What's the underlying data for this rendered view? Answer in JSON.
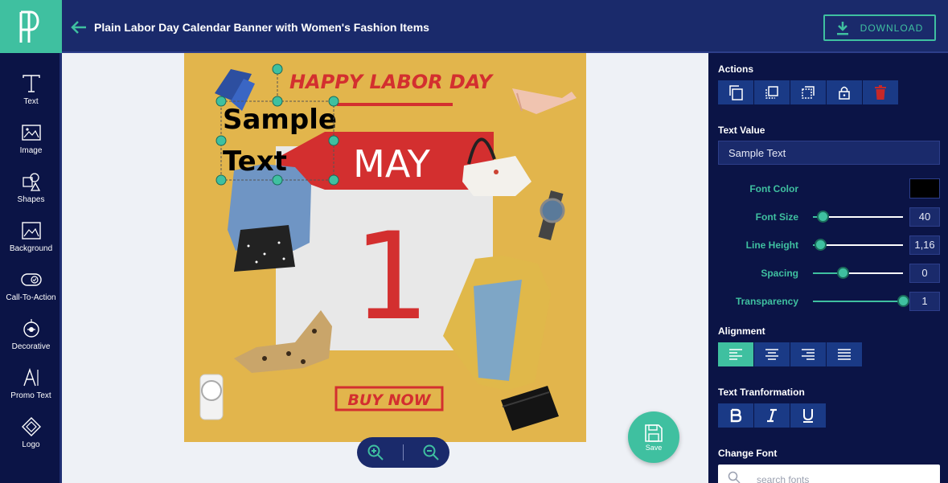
{
  "header": {
    "title": "Plain Labor Day Calendar Banner with Women's Fashion Items",
    "download_label": "DOWNLOAD"
  },
  "sidebar": {
    "items": [
      {
        "label": "Text",
        "icon": "text-icon"
      },
      {
        "label": "Image",
        "icon": "image-icon"
      },
      {
        "label": "Shapes",
        "icon": "shapes-icon"
      },
      {
        "label": "Background",
        "icon": "background-icon"
      },
      {
        "label": "Call-To-Action",
        "icon": "cta-icon"
      },
      {
        "label": "Decorative",
        "icon": "decorative-icon"
      },
      {
        "label": "Promo Text",
        "icon": "promo-text-icon"
      },
      {
        "label": "Logo",
        "icon": "logo-icon"
      }
    ]
  },
  "canvas": {
    "headline": "HAPPY LABOR DAY",
    "month": "MAY",
    "day": "1",
    "cta": "BUY NOW",
    "selected_text_line1": "Sample",
    "selected_text_line2": "Text"
  },
  "save_label": "Save",
  "panel": {
    "actions_title": "Actions",
    "text_value_title": "Text Value",
    "text_value": "Sample Text",
    "font_color_label": "Font Color",
    "font_color": "#000000",
    "font_size_label": "Font Size",
    "font_size": "40",
    "line_height_label": "Line Height",
    "line_height": "1,16",
    "spacing_label": "Spacing",
    "spacing": "0",
    "transparency_label": "Transparency",
    "transparency": "1",
    "alignment_title": "Alignment",
    "transformation_title": "Text Tranformation",
    "change_font_title": "Change Font",
    "search_placeholder": "search fonts"
  },
  "colors": {
    "accent": "#3fc0a0",
    "navy": "#0b1446",
    "header": "#1a2a6b",
    "canvas_bg": "#e2b54c",
    "red": "#d32f2f",
    "delete": "#c62828"
  }
}
